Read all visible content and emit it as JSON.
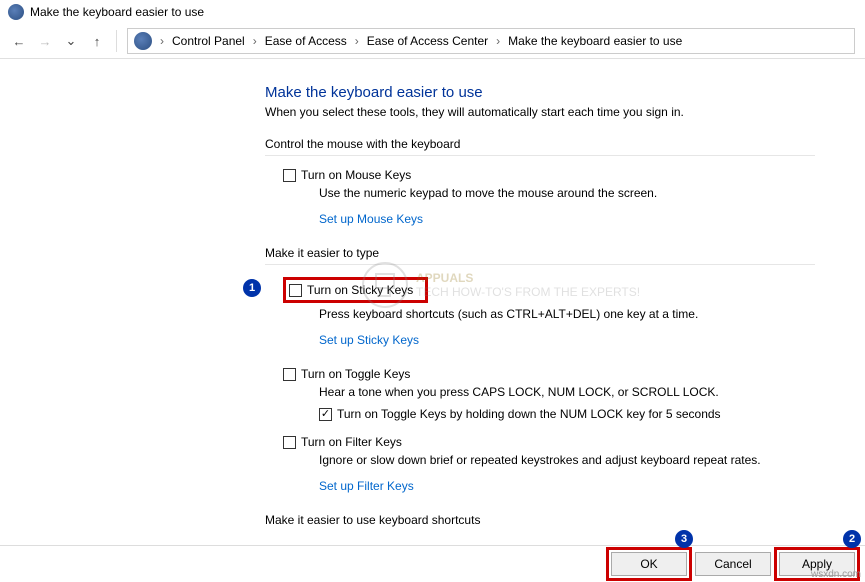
{
  "title": "Make the keyboard easier to use",
  "breadcrumbs": [
    "Control Panel",
    "Ease of Access",
    "Ease of Access Center",
    "Make the keyboard easier to use"
  ],
  "page": {
    "heading": "Make the keyboard easier to use",
    "subtitle": "When you select these tools, they will automatically start each time you sign in.",
    "section1": {
      "header": "Control the mouse with the keyboard",
      "opt1_label": "Turn on Mouse Keys",
      "opt1_desc": "Use the numeric keypad to move the mouse around the screen.",
      "link1": "Set up Mouse Keys"
    },
    "section2": {
      "header": "Make it easier to type",
      "opt1_label": "Turn on Sticky Keys",
      "opt1_desc": "Press keyboard shortcuts (such as CTRL+ALT+DEL) one key at a time.",
      "link1": "Set up Sticky Keys",
      "opt2_label": "Turn on Toggle Keys",
      "opt2_desc": "Hear a tone when you press CAPS LOCK, NUM LOCK, or SCROLL LOCK.",
      "opt2_sub": "Turn on Toggle Keys by holding down the NUM LOCK key for 5 seconds",
      "opt3_label": "Turn on Filter Keys",
      "opt3_desc": "Ignore or slow down brief or repeated keystrokes and adjust keyboard repeat rates.",
      "link3": "Set up Filter Keys"
    },
    "section3": {
      "header": "Make it easier to use keyboard shortcuts"
    }
  },
  "buttons": {
    "ok": "OK",
    "cancel": "Cancel",
    "apply": "Apply"
  },
  "watermark": {
    "brand": "APPUALS",
    "tag": "TECH HOW-TO'S FROM THE EXPERTS!"
  },
  "attribution": "wsxdn.com",
  "callouts": {
    "c1": "1",
    "c2": "2",
    "c3": "3"
  }
}
